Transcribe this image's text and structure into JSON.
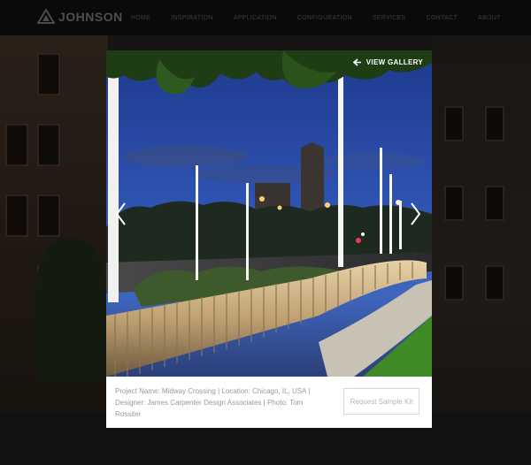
{
  "brand": {
    "name": "JOHNSON",
    "tagline": ""
  },
  "nav": {
    "items": [
      "HOME",
      "INSPIRATION",
      "APPLICATION",
      "CONFIGURATION",
      "SERVICES",
      "CONTACT",
      "ABOUT"
    ]
  },
  "modal": {
    "view_gallery_label": "VIEW GALLERY",
    "photo_alt": "Midway Crossing illuminated at night",
    "caption": {
      "project_label": "Project Name:",
      "project_name": "Midway Crossing",
      "location_label": "Location:",
      "location": "Chicago, IL, USA",
      "designer_label": "Designer:",
      "designer": "James Carpenter Design Associates",
      "photo_label": "Photo:",
      "photographer": "Tom Rossiter"
    },
    "request_button_label": "Request Sample Kit"
  },
  "icons": {
    "logo": "triangle-logo-icon",
    "view_gallery": "arrow-left-icon",
    "prev": "chevron-left-icon",
    "next": "chevron-right-icon"
  },
  "colors": {
    "nav_bg": "#0a0a0a",
    "overlay_bg": "#0c0c0d",
    "modal_bg": "#ffffff",
    "caption_text": "#9a9a9a",
    "button_border": "#d6d6d6"
  }
}
